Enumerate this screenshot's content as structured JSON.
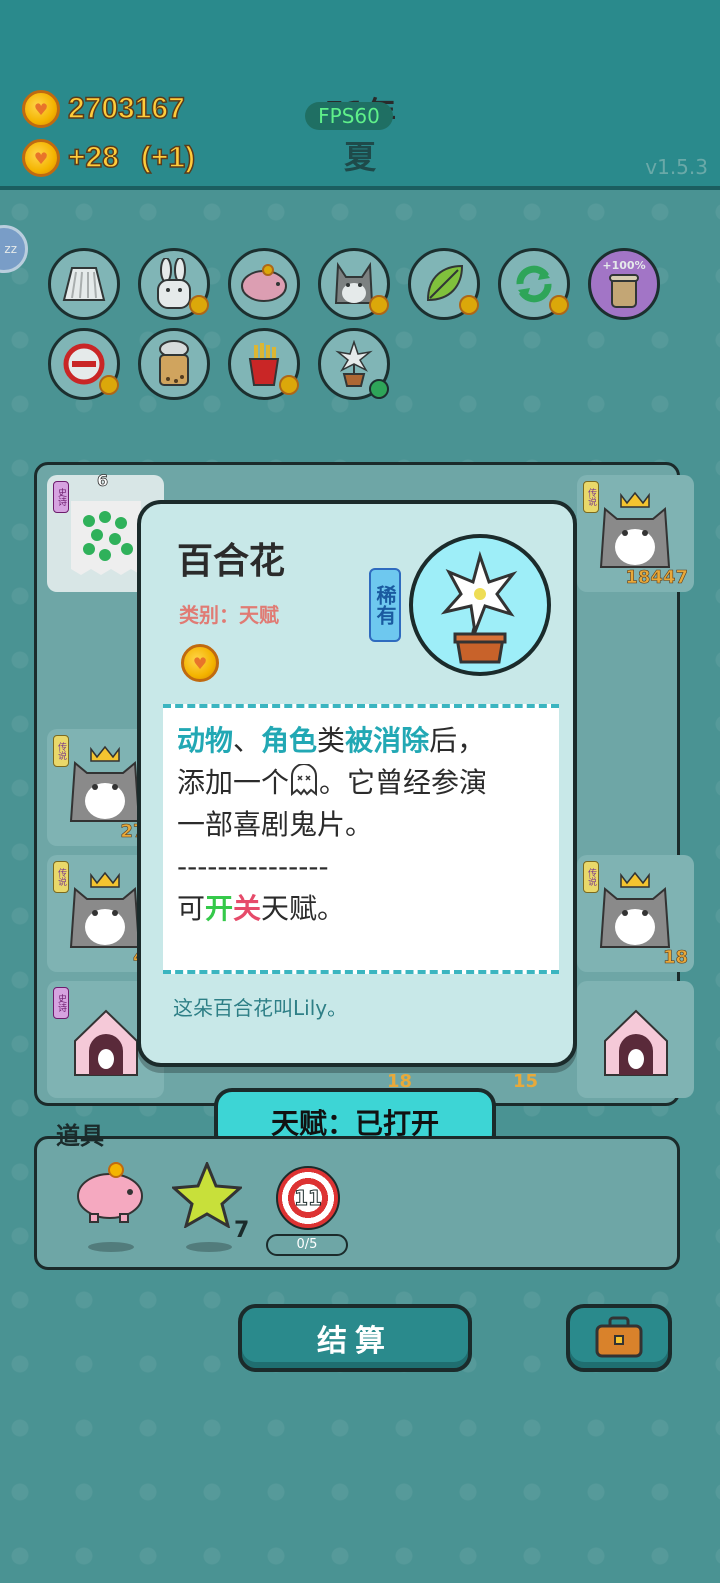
{
  "header": {
    "coins": "2703167",
    "income": "+28",
    "income_bonus": "(+1)",
    "year": "51年",
    "fps": "FPS60",
    "season": "夏",
    "version": "v1.5.3",
    "sleep": "zz"
  },
  "talents": [
    {
      "icon": "skirt-icon"
    },
    {
      "icon": "rabbit-icon"
    },
    {
      "icon": "piggy-bank-icon"
    },
    {
      "icon": "husky-icon"
    },
    {
      "icon": "leaf-icon"
    },
    {
      "icon": "refresh-icon"
    },
    {
      "icon": "milk-tea-icon",
      "percent": "+100%"
    },
    {
      "icon": "no-entry-icon"
    },
    {
      "icon": "bubble-tea-icon"
    },
    {
      "icon": "fries-icon"
    },
    {
      "icon": "lily-icon"
    }
  ],
  "board": {
    "cells": [
      {
        "tag": "史诗",
        "count": "6"
      },
      {
        "tag": "传说",
        "count": "18447"
      },
      {
        "tag": "传说",
        "count": "276"
      },
      {
        "tag": "传说",
        "count": "46"
      },
      {
        "tag": "传说",
        "count": "18"
      },
      {
        "tag": "史诗",
        "count": ""
      },
      {
        "tag": "",
        "count": "18"
      },
      {
        "tag": "",
        "count": "15"
      }
    ]
  },
  "card": {
    "title": "百合花",
    "category": "类别：天赋",
    "rarity": "稀有",
    "desc_line1_a": "动物",
    "desc_line1_b": "、",
    "desc_line1_c": "角色",
    "desc_line1_d": "类",
    "desc_line1_e": "被消除",
    "desc_line1_f": "后，",
    "desc_line2_a": "添加一个",
    "desc_line2_b": "。它曾经参演",
    "desc_line3": "一部喜剧鬼片。",
    "divider": "---------------",
    "desc_line5_a": "可",
    "desc_line5_b": "开",
    "desc_line5_c": "关",
    "desc_line5_d": "天赋。",
    "flavor": "这朵百合花叫Lily。"
  },
  "toggle_button": "天赋：已打开",
  "tools": {
    "label": "道具",
    "star_count": "7",
    "target_number": "11",
    "target_progress": "0/5"
  },
  "actions": {
    "settle": "结算"
  },
  "colors": {
    "accent": "#3dd5d5",
    "teal": "#2a8a8c",
    "coin_text": "#ffcc3a",
    "highlight": "#22a8b4",
    "on": "#35c94a",
    "off": "#e64b6a"
  }
}
